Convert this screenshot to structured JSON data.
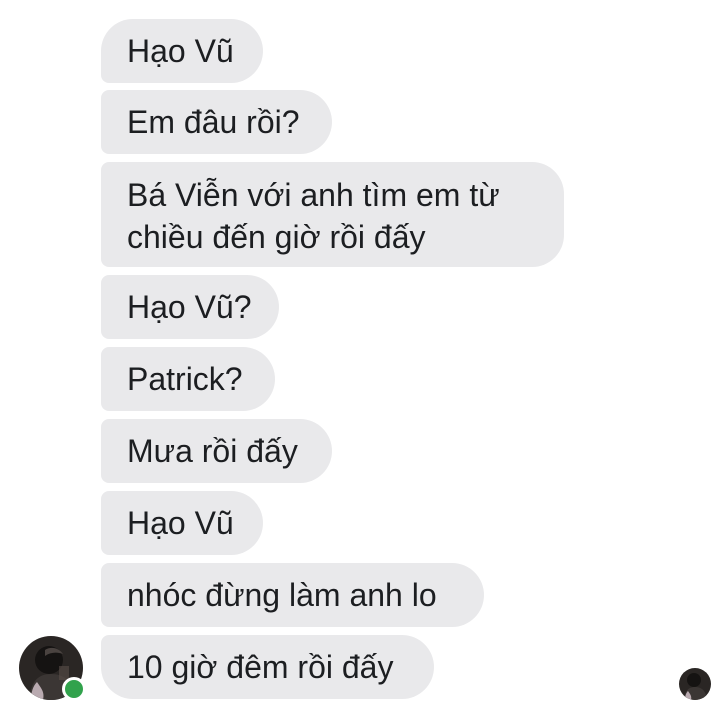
{
  "conversation": {
    "messages": [
      {
        "text": "Hạo Vũ"
      },
      {
        "text": "Em đâu rồi?"
      },
      {
        "text": "Bá Viễn với anh tìm em từ chiều đến giờ rồi đấy"
      },
      {
        "text": "Hạo Vũ?"
      },
      {
        "text": "Patrick?"
      },
      {
        "text": "Mưa rồi đấy"
      },
      {
        "text": "Hạo Vũ"
      },
      {
        "text": "nhóc đừng làm anh lo"
      },
      {
        "text": "10 giờ đêm rồi đấy"
      }
    ]
  },
  "sender": {
    "avatar_icon": "avatar-photo-icon",
    "status": "online",
    "status_color": "#31a24c"
  },
  "read_receipt": {
    "icon": "seen-avatar-icon"
  },
  "colors": {
    "bubble_background": "#e9e9eb",
    "text": "#1c1e21",
    "background": "#ffffff"
  }
}
